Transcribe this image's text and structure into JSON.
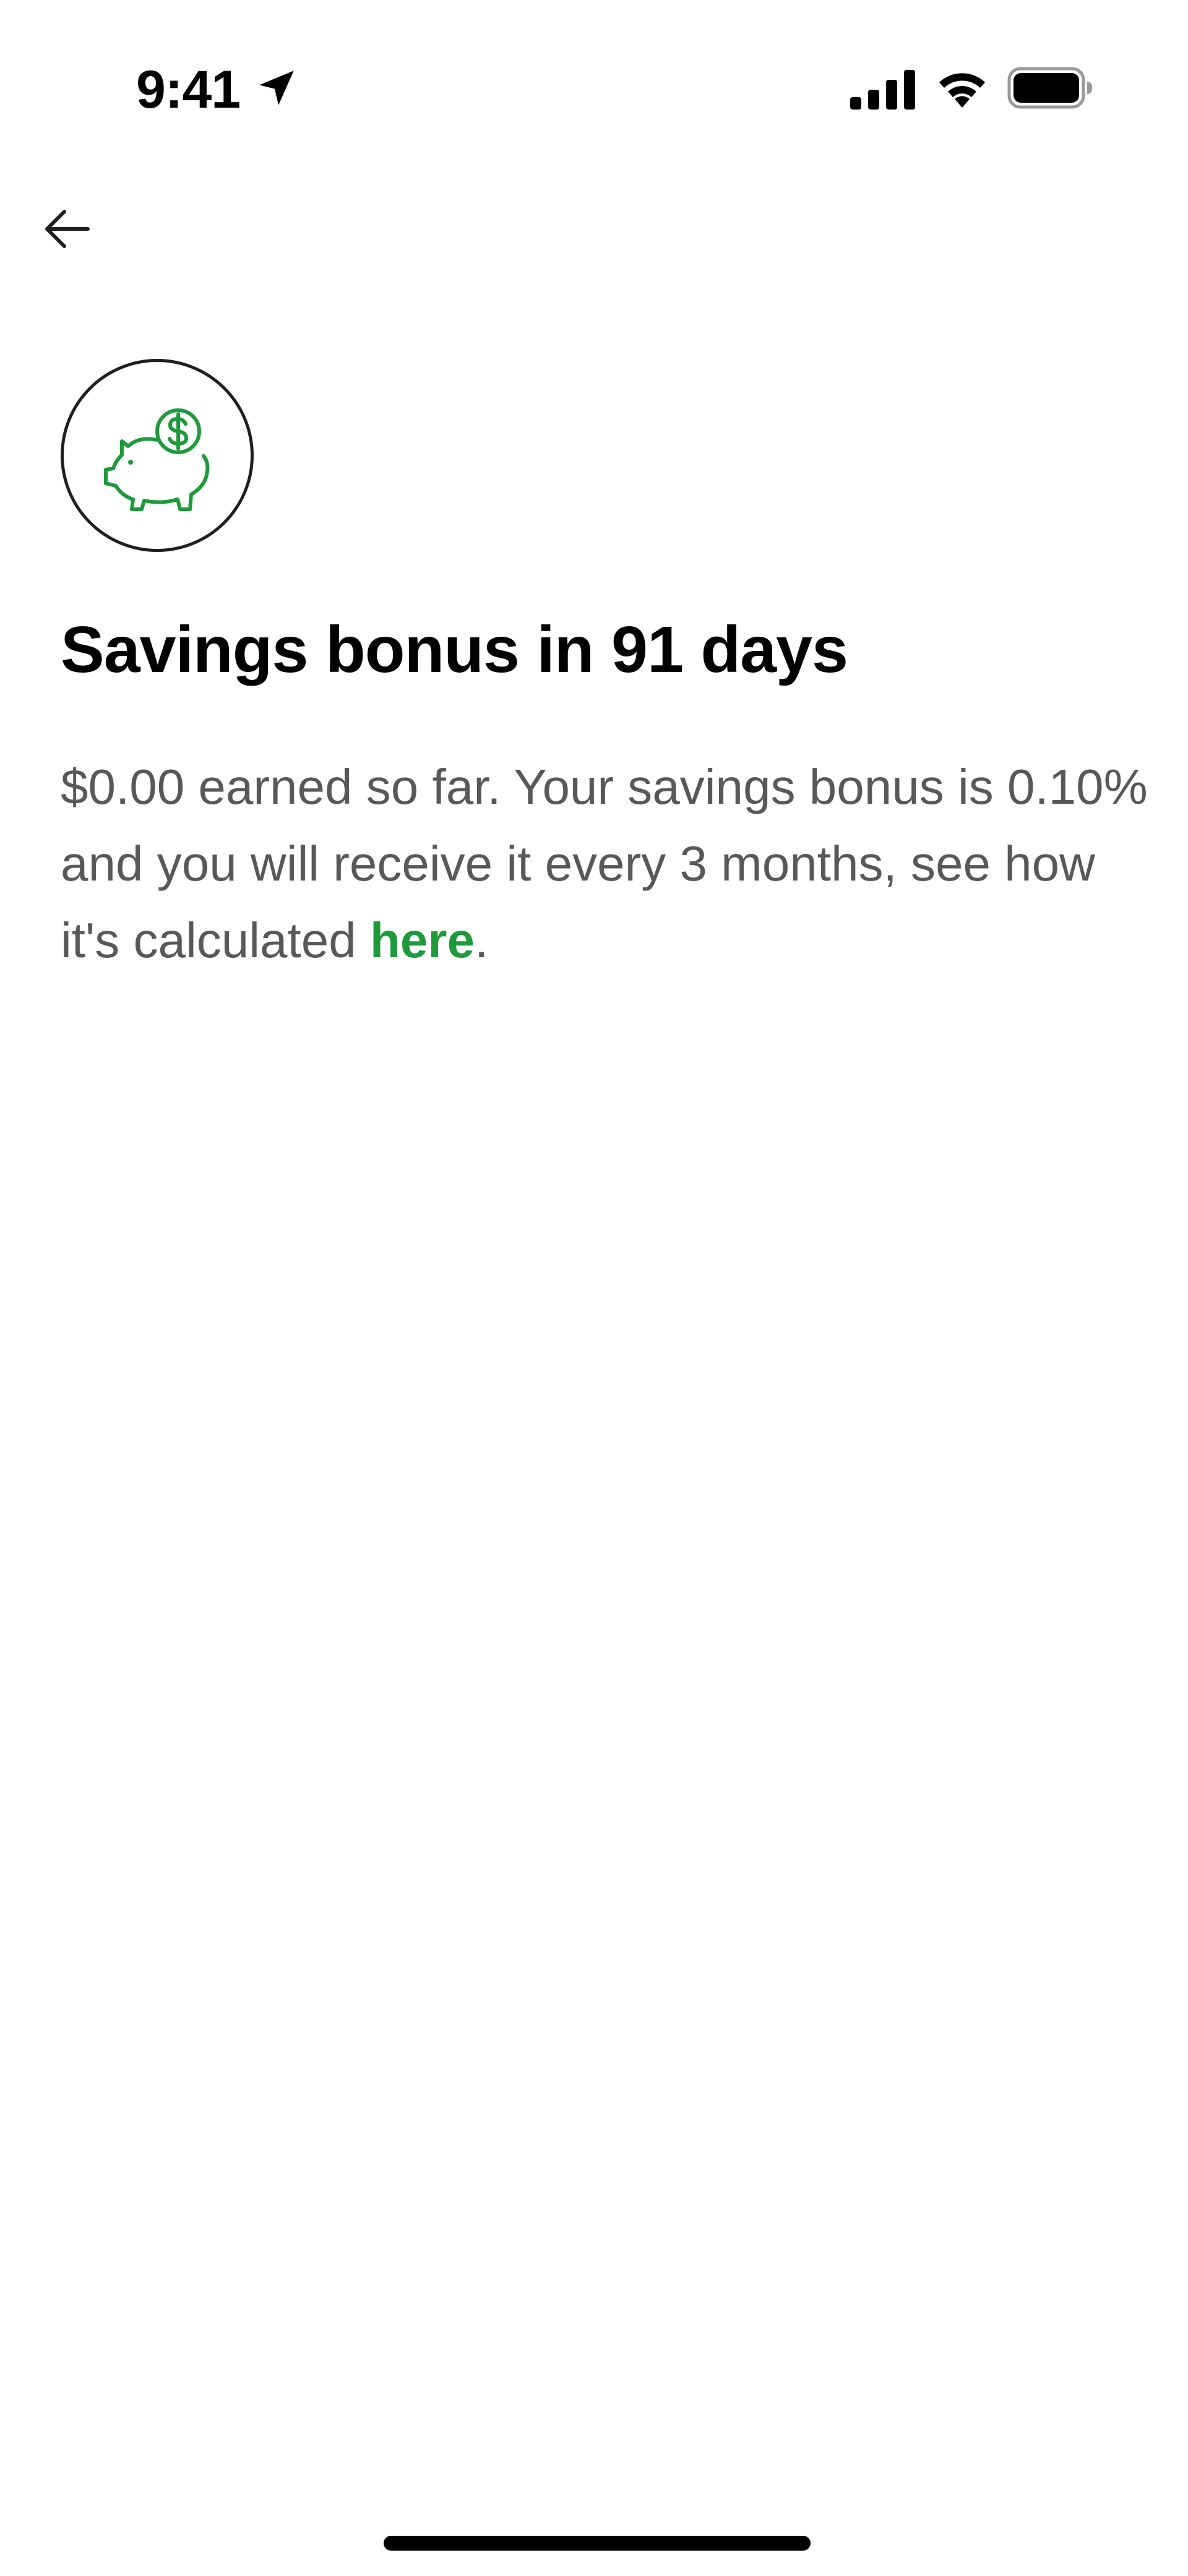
{
  "status_bar": {
    "time": "9:41",
    "icons": [
      "location-arrow-icon",
      "cellular-signal-icon",
      "wifi-icon",
      "battery-icon"
    ]
  },
  "navigation": {
    "back_icon": "arrow-left-icon"
  },
  "header_icon": {
    "name": "piggy-bank-dollar-icon",
    "color": "#1e9a3c"
  },
  "title": "Savings bonus in 91 days",
  "description": {
    "text_before_link": "$0.00 earned so far. Your savings bonus is 0.10% and you will receive it every 3 months, see how it's calculated ",
    "link_text": "here",
    "text_after_link": "."
  },
  "colors": {
    "accent": "#1e9a3c",
    "body_text": "#585858",
    "title_text": "#000000",
    "background": "#ffffff"
  }
}
